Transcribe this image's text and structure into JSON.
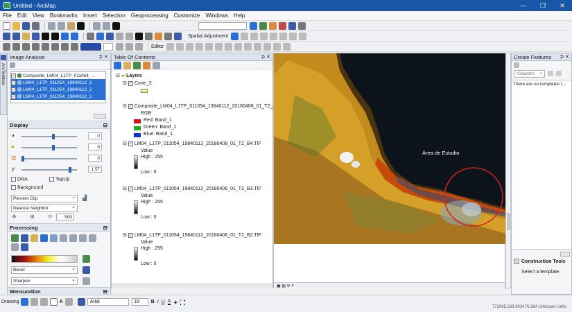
{
  "window": {
    "title": "Untitled - ArcMap"
  },
  "menu": [
    "File",
    "Edit",
    "View",
    "Bookmarks",
    "Insert",
    "Selection",
    "Geoprocessing",
    "Customize",
    "Windows",
    "Help"
  ],
  "toolbar": {
    "spatial_adjustment": "Spatial Adjustment",
    "editor": "Editor"
  },
  "image_analysis": {
    "title": "Image Analysis",
    "layers": [
      "Composite_LM04_L1TP_011054_...",
      "LM04_L1TP_011054_19840112_2",
      "LM04_L1TP_011054_19840112_2",
      "LM04_L1TP_011054_19840112_2"
    ],
    "display_label": "Display",
    "values": [
      "0",
      "0",
      "0",
      "1.57"
    ],
    "dra": "DRA",
    "topup": "TopUp",
    "background": "Background",
    "stretch": "Percent Clip",
    "resample": "Nearest Neighbor",
    "value_500": "500",
    "processing_label": "Processing",
    "blend": "Blend",
    "sharpen": "Sharpen",
    "mensuration_label": "Mensuration"
  },
  "toc": {
    "title": "Table Of Contents",
    "layers_label": "Layers",
    "corte": "Corte_2",
    "composite": "Composite_LM04_L1TP_011054_19840112_20180408_01_T2_B",
    "rgb": "RGB",
    "red": "Red:   Band_1",
    "green": "Green: Band_1",
    "blue": "Blue:  Band_1",
    "b4": "LM04_L1TP_011054_19840112_20180408_01_T2_B4.TIF",
    "b3": "LM04_L1TP_011054_19840112_20180408_01_T2_B3.TIF",
    "b2": "LM04_L1TP_011054_19840112_20180408_01_T2_B2.TIF",
    "value": "Value",
    "high": "High : 255",
    "low": "Low : 0"
  },
  "map": {
    "annotation": "Área de Estudio"
  },
  "create_features": {
    "title": "Create Features",
    "search": "<Search>",
    "message": "There are no templates t...",
    "construction_tools": "Construction Tools",
    "select_template": "Select a template."
  },
  "drawing_toolbar": {
    "drawing": "Drawing",
    "font": "Arial",
    "size": "10"
  },
  "status": {
    "coords": "772065.233  803476.264 Unknown Units"
  },
  "colors": {
    "title_bar": "#1a56a8",
    "selection": "#2a6fd6",
    "red": "#e01010",
    "green": "#1faa1f",
    "blue": "#1030d0"
  }
}
